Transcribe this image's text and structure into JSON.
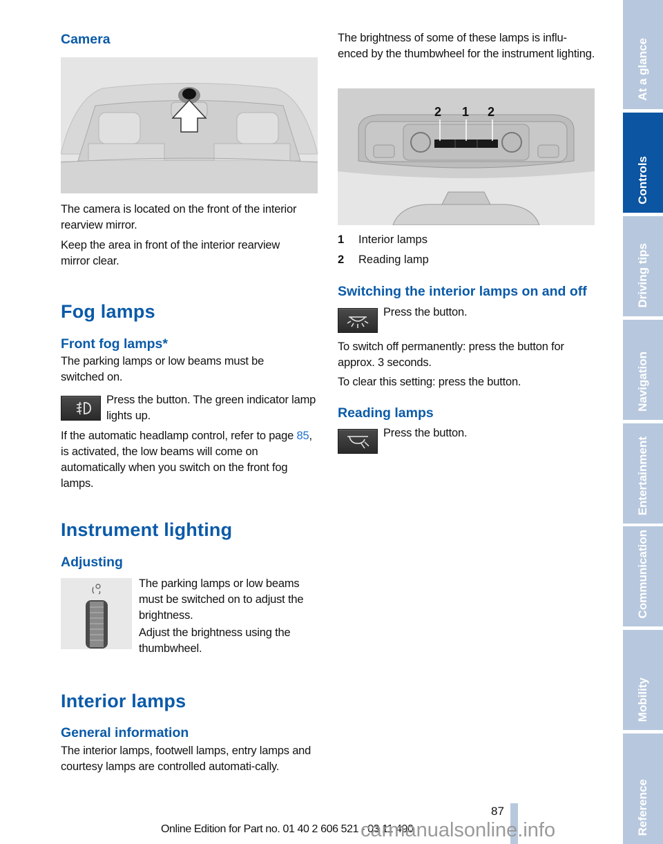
{
  "left_column": {
    "camera": {
      "heading": "Camera",
      "figure_alt": "camera-on-interior-rearview-mirror-illustration",
      "paragraphs": [
        "The camera is located on the front of the interior rearview mirror.",
        "Keep the area in front of the interior rearview mirror clear."
      ]
    },
    "fog_lamps": {
      "heading": "Fog lamps",
      "subheading": "Front fog lamps*",
      "intro": "The parking lamps or low beams must be switched on.",
      "button_text": "Press the button. The green indicator lamp lights up.",
      "button_icon": "front-fog-lamp-icon",
      "note_before_link": "If the automatic headlamp control, refer to page ",
      "note_link": "85",
      "note_after_link": ", is activated, the low beams will come on automatically when you switch on the front fog lamps."
    },
    "instrument_lighting": {
      "heading": "Instrument lighting",
      "subheading": "Adjusting",
      "figure_alt": "instrument-lighting-thumbwheel",
      "paragraphs": [
        "The parking lamps or low beams must be switched on to adjust the brightness.",
        "Adjust the brightness using the thumbwheel."
      ]
    },
    "interior_lamps": {
      "heading": "Interior lamps",
      "subheading": "General information",
      "paragraph": "The interior lamps, footwell lamps, entry lamps and courtesy lamps are controlled automati-cally."
    }
  },
  "right_column": {
    "intro": "The brightness of some of these lamps is influ-enced by the thumbwheel for the instrument lighting.",
    "figure_alt": "overhead-console-illustration",
    "figure_callouts": [
      "2",
      "1",
      "2"
    ],
    "legend": [
      {
        "num": "1",
        "label": "Interior lamps"
      },
      {
        "num": "2",
        "label": "Reading lamp"
      }
    ],
    "switching": {
      "heading": "Switching the interior lamps on and off",
      "button_text": "Press the button.",
      "button_icon": "interior-lamp-icon",
      "paragraphs": [
        "To switch off permanently: press the button for approx. 3 seconds.",
        "To clear this setting: press the button."
      ]
    },
    "reading": {
      "heading": "Reading lamps",
      "button_text": "Press the button.",
      "button_icon": "reading-lamp-icon"
    }
  },
  "sidebar": {
    "tabs": [
      {
        "label": "At a glance",
        "active": false
      },
      {
        "label": "Controls",
        "active": true
      },
      {
        "label": "Driving tips",
        "active": false
      },
      {
        "label": "Navigation",
        "active": false
      },
      {
        "label": "Entertainment",
        "active": false
      },
      {
        "label": "Communication",
        "active": false
      },
      {
        "label": "Mobility",
        "active": false
      },
      {
        "label": "Reference",
        "active": false
      }
    ]
  },
  "footer": {
    "page_number": "87",
    "edition_text": "Online Edition for Part no. 01 40 2 606 521 - 03 11 490",
    "watermark": "carmanualsonline.info"
  },
  "colors": {
    "heading_blue": "#0a5aa8",
    "link_blue": "#1f6fd1",
    "tab_inactive": "#b7c8de",
    "tab_active": "#0b55a2"
  }
}
